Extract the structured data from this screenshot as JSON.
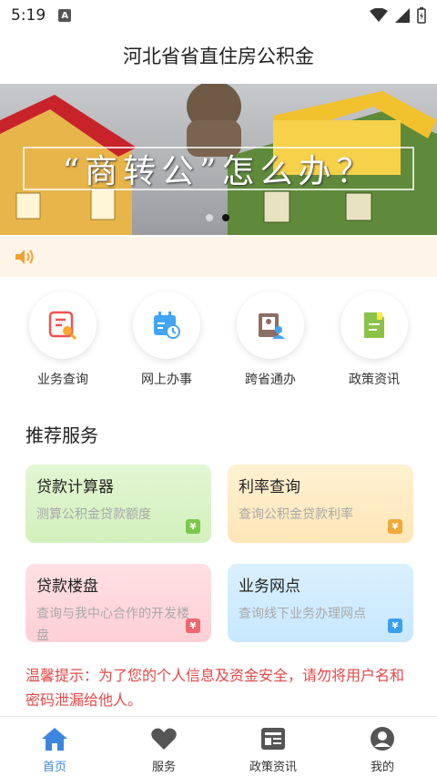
{
  "status": {
    "time": "5:19",
    "notif_icon": "A"
  },
  "app_title": "河北省省直住房公积金",
  "banner": {
    "headline": "“商转公”怎么办？",
    "slide_count": 2,
    "active_slide": 2
  },
  "notice": {
    "icon": "speaker-icon"
  },
  "quick_actions": [
    {
      "label": "业务查询",
      "icon": "search-document-icon"
    },
    {
      "label": "网上办事",
      "icon": "calendar-clock-icon"
    },
    {
      "label": "跨省通办",
      "icon": "book-user-icon"
    },
    {
      "label": "政策资讯",
      "icon": "policy-document-icon"
    }
  ],
  "section_title": "推荐服务",
  "services": [
    {
      "title": "贷款计算器",
      "subtitle": "测算公积金贷款额度",
      "badge": "¥",
      "color": "#7cc84a"
    },
    {
      "title": "利率查询",
      "subtitle": "查询公积金贷款利率",
      "badge": "¥",
      "color": "#f0a93a"
    },
    {
      "title": "贷款楼盘",
      "subtitle": "查询与我中心合作的开发楼盘",
      "badge": "¥",
      "color": "#ee6970"
    },
    {
      "title": "业务网点",
      "subtitle": "查询线下业务办理网点",
      "badge": "¥",
      "color": "#3b9ff0"
    }
  ],
  "tip": "温馨提示：为了您的个人信息及资金安全，请勿将用户名和密码泄漏给他人。",
  "tabs": [
    {
      "label": "首页",
      "icon": "home-icon",
      "active": true
    },
    {
      "label": "服务",
      "icon": "heart-icon",
      "active": false
    },
    {
      "label": "政策资讯",
      "icon": "news-icon",
      "active": false
    },
    {
      "label": "我的",
      "icon": "user-icon",
      "active": false
    }
  ],
  "colors": {
    "accent": "#3c86e0",
    "tip_red": "#e54747",
    "notice_bg": "#fef4e8"
  }
}
